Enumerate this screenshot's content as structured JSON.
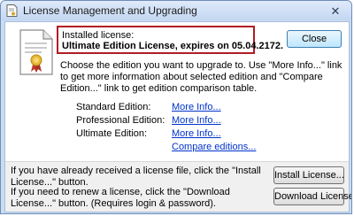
{
  "window": {
    "title": "License Management and Upgrading",
    "close_glyph": "✕"
  },
  "license": {
    "label": "Installed license:",
    "value": "Ultimate Edition License, expires on 05.04.2172."
  },
  "buttons": {
    "close": "Close",
    "install": "Install License...",
    "download": "Download License..."
  },
  "instructions": "Choose the edition you want to upgrade to. Use \"More Info...\" link to get more information about selected edition and \"Compare Edition...\" link to get edition comparison table.",
  "editions": [
    {
      "label": "Standard Edition:",
      "link": "More Info..."
    },
    {
      "label": "Professional Edition:",
      "link": "More Info..."
    },
    {
      "label": "Ultimate Edition:",
      "link": "More Info..."
    }
  ],
  "compare_link": "Compare editions...",
  "bottom": {
    "install_text": "If you have already received a license file, click the \"Install License...\" button.",
    "download_text": "If you need to renew a license, click the \"Download License...\" button. (Requires login & password)."
  },
  "icons": {
    "title": "license-document-icon",
    "doc": "certificate-document-icon",
    "close": "close-icon"
  },
  "colors": {
    "highlight_border": "#b11c24",
    "link": "#0033cc"
  }
}
